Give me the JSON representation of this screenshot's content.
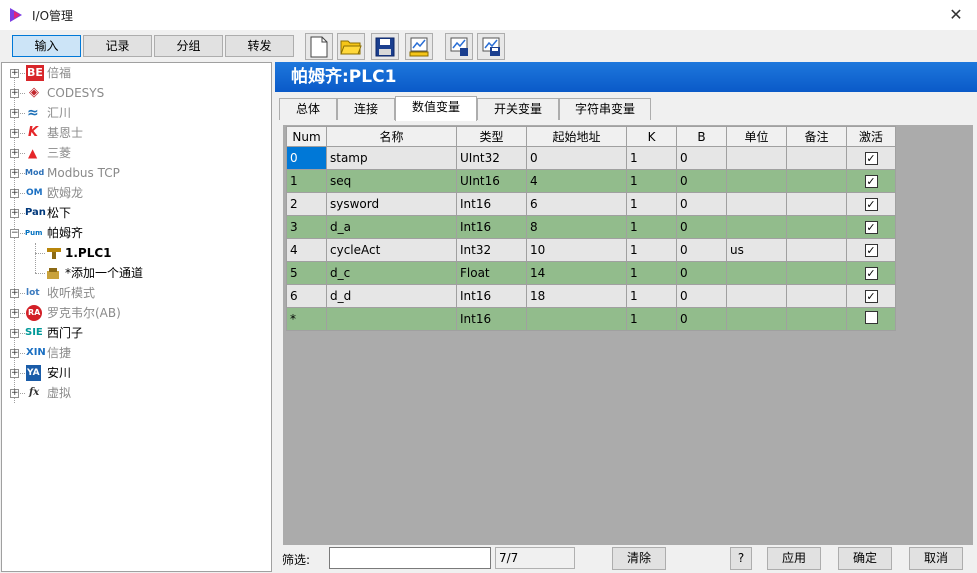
{
  "window": {
    "title": "I/O管理",
    "close_glyph": "✕"
  },
  "toolbar": {
    "buttons": [
      "输入",
      "记录",
      "分组",
      "转发"
    ],
    "icons": [
      "new-file-icon",
      "open-folder-icon",
      "save-disk-icon",
      "import-chart-icon",
      "export-chart-icon",
      "save-chart-icon"
    ]
  },
  "tree": {
    "nodes": [
      {
        "logo": "BE",
        "label": "倍福",
        "logo_color": "#d8262a"
      },
      {
        "logo": "◈",
        "label": "CODESYS",
        "logo_color": "#c2272d"
      },
      {
        "logo": "≈",
        "label": "汇川",
        "logo_color": "#1b6fb7"
      },
      {
        "logo": "K",
        "label": "基恩士",
        "logo_color": "#e52629"
      },
      {
        "logo": "▲",
        "label": "三菱",
        "logo_color": "#e52629"
      },
      {
        "logo": "Mod",
        "label": "Modbus TCP",
        "logo_color": "#2a6fb7"
      },
      {
        "logo": "OM",
        "label": "欧姆龙",
        "logo_color": "#1a6fc2"
      },
      {
        "logo": "Pan",
        "label": "松下",
        "logo_color": "#00387b"
      },
      {
        "logo": "Pum",
        "label": "帕姆齐",
        "logo_color": "#0070c0"
      },
      {
        "logo": "",
        "label": "1.PLC1"
      },
      {
        "logo": "",
        "label": "*添加一个通道"
      },
      {
        "logo": "lot",
        "label": "收听模式",
        "logo_color": "#3c7bbf"
      },
      {
        "logo": "RA",
        "label": "罗克韦尔(AB)",
        "logo_color": "#d32027"
      },
      {
        "logo": "SIE",
        "label": "西门子",
        "logo_color": "#009999"
      },
      {
        "logo": "XIN",
        "label": "信捷",
        "logo_color": "#1a6fc2"
      },
      {
        "logo": "YA",
        "label": "安川",
        "logo_color": "#1a5ca8"
      },
      {
        "logo": "fx",
        "label": "虚拟",
        "logo_color": "#333333"
      }
    ]
  },
  "panel": {
    "header": "帕姆齐:PLC1",
    "tabs": [
      "总体",
      "连接",
      "数值变量",
      "开关变量",
      "字符串变量"
    ],
    "active_tab": "数值变量"
  },
  "grid": {
    "columns": [
      "Num",
      "名称",
      "类型",
      "起始地址",
      "K",
      "B",
      "单位",
      "备注",
      "激活"
    ],
    "rows": [
      [
        "0",
        "stamp",
        "UInt32",
        "0",
        "1",
        "0",
        "",
        "",
        "✓"
      ],
      [
        "1",
        "seq",
        "UInt16",
        "4",
        "1",
        "0",
        "",
        "",
        "✓"
      ],
      [
        "2",
        "sysword",
        "Int16",
        "6",
        "1",
        "0",
        "",
        "",
        "✓"
      ],
      [
        "3",
        "d_a",
        "Int16",
        "8",
        "1",
        "0",
        "",
        "",
        "✓"
      ],
      [
        "4",
        "cycleAct",
        "Int32",
        "10",
        "1",
        "0",
        "us",
        "",
        "✓"
      ],
      [
        "5",
        "d_c",
        "Float",
        "14",
        "1",
        "0",
        "",
        "",
        "✓"
      ],
      [
        "6",
        "d_d",
        "Int16",
        "18",
        "1",
        "0",
        "",
        "",
        "✓"
      ],
      [
        "*",
        "",
        "Int16",
        "",
        "1",
        "0",
        "",
        "",
        ""
      ]
    ]
  },
  "footer": {
    "filter_label": "筛选:",
    "filter_value": "",
    "count": "7/7",
    "clear": "清除",
    "help": "?",
    "apply": "应用",
    "ok": "确定",
    "cancel": "取消"
  }
}
